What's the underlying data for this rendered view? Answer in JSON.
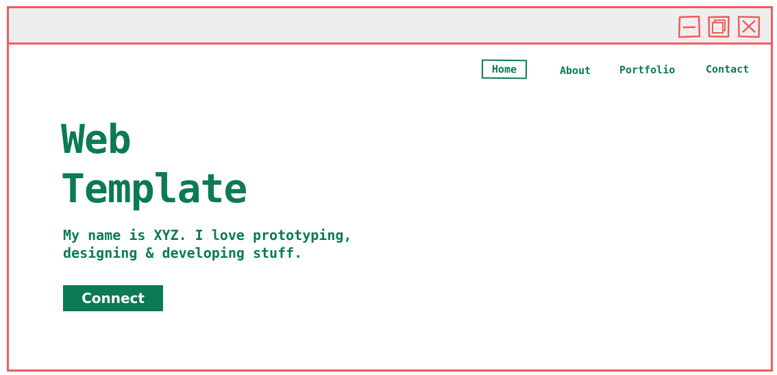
{
  "window": {
    "controls": {
      "minimize_icon": "minimize-icon",
      "maximize_icon": "maximize-icon",
      "close_icon": "close-icon"
    },
    "frame_color": "#f05a5b",
    "titlebar_color": "#eeeeee"
  },
  "nav": {
    "items": [
      {
        "label": "Home",
        "active": true
      },
      {
        "label": "About",
        "active": false
      },
      {
        "label": "Portfolio",
        "active": false
      },
      {
        "label": "Contact",
        "active": false
      }
    ]
  },
  "hero": {
    "title_line1": "Web",
    "title_line2": "Template",
    "text_line1": "My name is XYZ. I love prototyping,",
    "text_line2": "designing & developing stuff.",
    "button_label": "Connect"
  },
  "colors": {
    "accent": "#0b7a55",
    "button_text": "#ffffff"
  }
}
